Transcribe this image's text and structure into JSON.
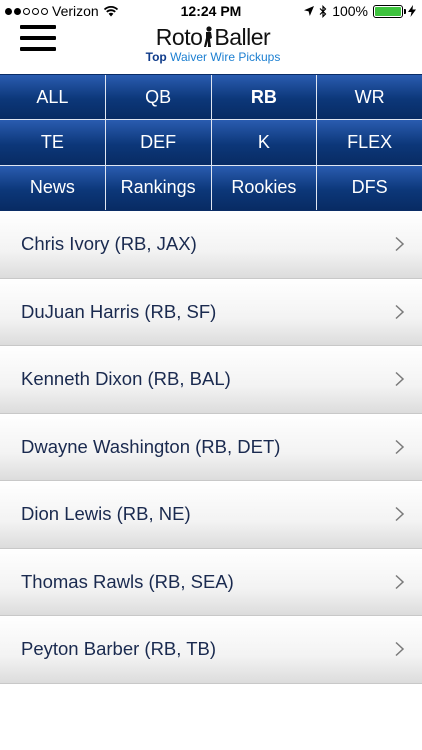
{
  "status_bar": {
    "carrier": "Verizon",
    "time": "12:24 PM",
    "battery": "100%",
    "signal_dots_filled": 2,
    "signal_dots_total": 5
  },
  "header": {
    "logo_left": "Roto",
    "logo_right": "Baller",
    "subtitle_bold": "Top",
    "subtitle_rest": " Waiver Wire Pickups"
  },
  "nav": {
    "items": [
      {
        "label": "ALL",
        "active": false
      },
      {
        "label": "QB",
        "active": false
      },
      {
        "label": "RB",
        "active": true
      },
      {
        "label": "WR",
        "active": false
      },
      {
        "label": "TE",
        "active": false
      },
      {
        "label": "DEF",
        "active": false
      },
      {
        "label": "K",
        "active": false
      },
      {
        "label": "FLEX",
        "active": false
      },
      {
        "label": "News",
        "active": false
      },
      {
        "label": "Rankings",
        "active": false
      },
      {
        "label": "Rookies",
        "active": false
      },
      {
        "label": "DFS",
        "active": false
      }
    ]
  },
  "players": [
    {
      "label": "Chris Ivory (RB, JAX)"
    },
    {
      "label": "DuJuan Harris (RB, SF)"
    },
    {
      "label": "Kenneth Dixon (RB, BAL)"
    },
    {
      "label": "Dwayne Washington (RB, DET)"
    },
    {
      "label": "Dion Lewis (RB, NE)"
    },
    {
      "label": "Thomas Rawls (RB, SEA)"
    },
    {
      "label": "Peyton Barber (RB, TB)"
    }
  ],
  "colors": {
    "nav_blue": "#0c3779",
    "logo_blue": "#1c7fd1",
    "battery_green": "#3ec33e"
  }
}
